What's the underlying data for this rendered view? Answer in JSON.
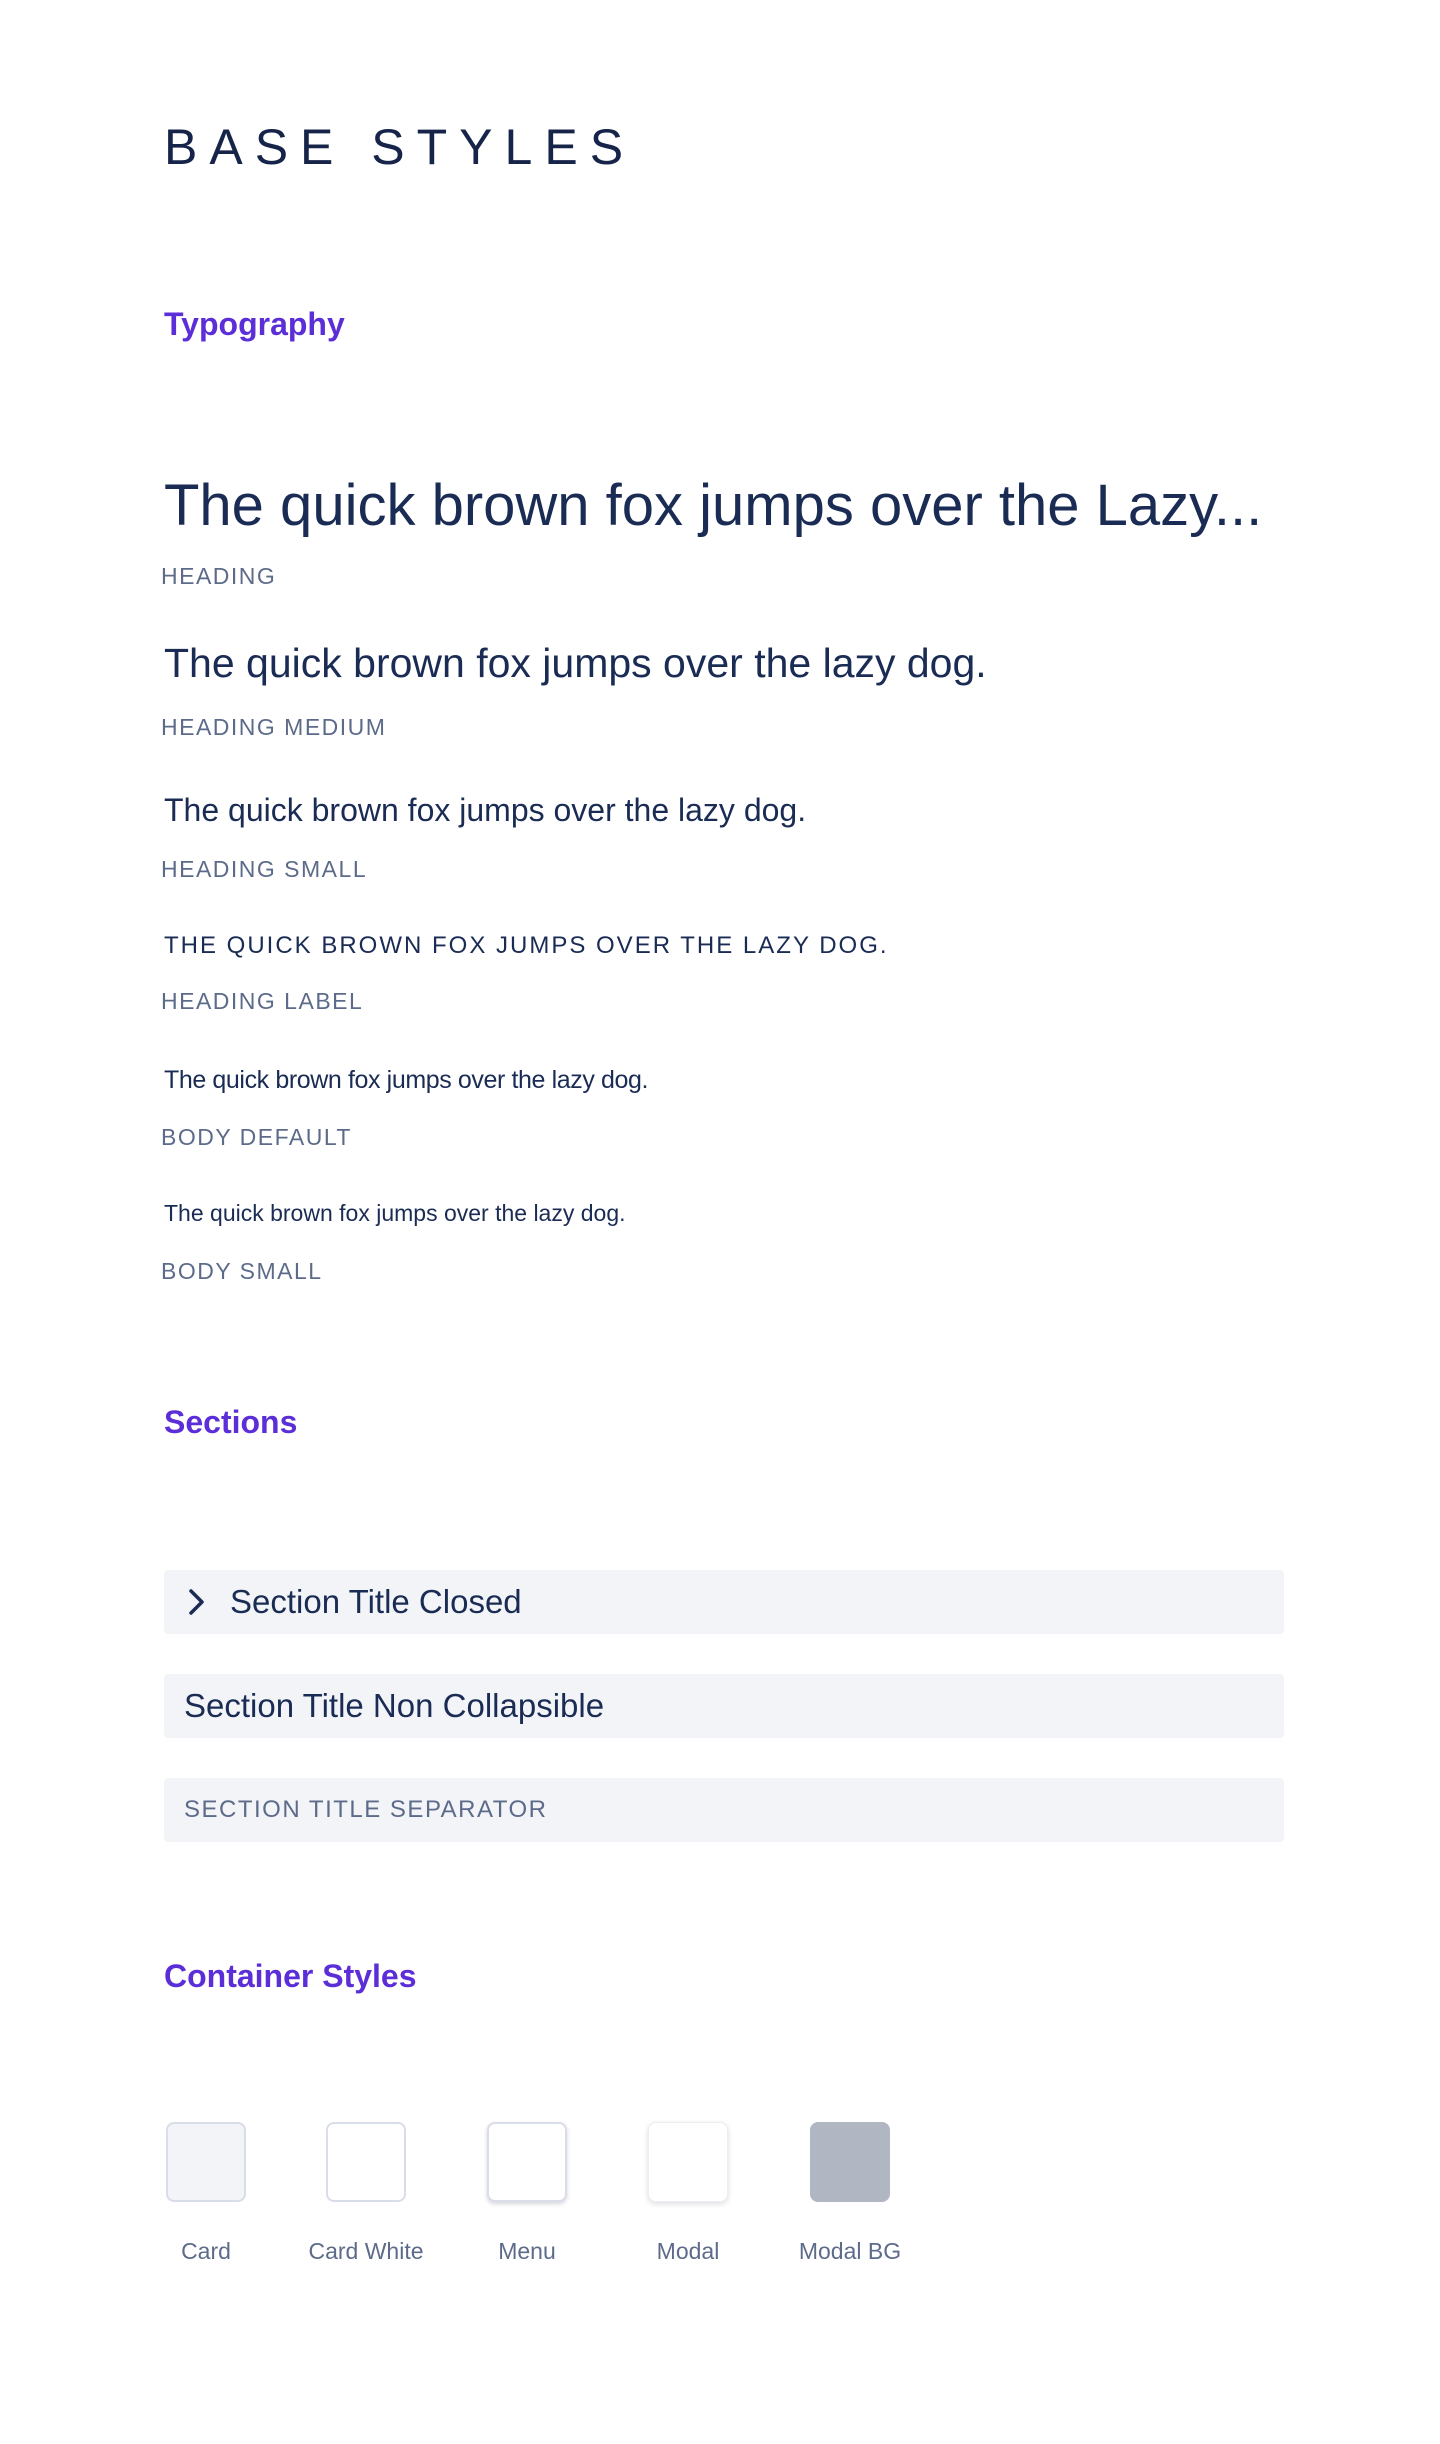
{
  "page": {
    "title": "BASE STYLES"
  },
  "typography": {
    "heading": "Typography",
    "samples": [
      {
        "text": "The quick brown fox jumps over the Lazy...",
        "caption": "HEADING"
      },
      {
        "text": "The quick brown fox jumps over the lazy dog.",
        "caption": "HEADING MEDIUM"
      },
      {
        "text": "The quick brown fox jumps over the lazy dog.",
        "caption": "HEADING SMALL"
      },
      {
        "text": "THE QUICK BROWN FOX JUMPS OVER THE LAZY DOG.",
        "caption": "HEADING LABEL"
      },
      {
        "text": "The quick brown fox jumps over the lazy dog.",
        "caption": "BODY DEFAULT"
      },
      {
        "text": "The quick brown fox jumps over the lazy dog.",
        "caption": "BODY SMALL"
      }
    ]
  },
  "sections": {
    "heading": "Sections",
    "items": [
      {
        "title": "Section Title Closed",
        "icon": "chevron-right-icon"
      },
      {
        "title": "Section Title Non Collapsible"
      },
      {
        "title": "SECTION TITLE SEPARATOR"
      }
    ]
  },
  "containers": {
    "heading": "Container Styles",
    "items": [
      {
        "label": "Card"
      },
      {
        "label": "Card White"
      },
      {
        "label": "Menu"
      },
      {
        "label": "Modal"
      },
      {
        "label": "Modal BG"
      }
    ]
  },
  "colors": {
    "accent": "#5b2ed8",
    "text": "#1a2b54",
    "muted": "#5d6b8a",
    "section_bg": "#f3f4f8",
    "modal_bg": "#b0b7c3"
  }
}
